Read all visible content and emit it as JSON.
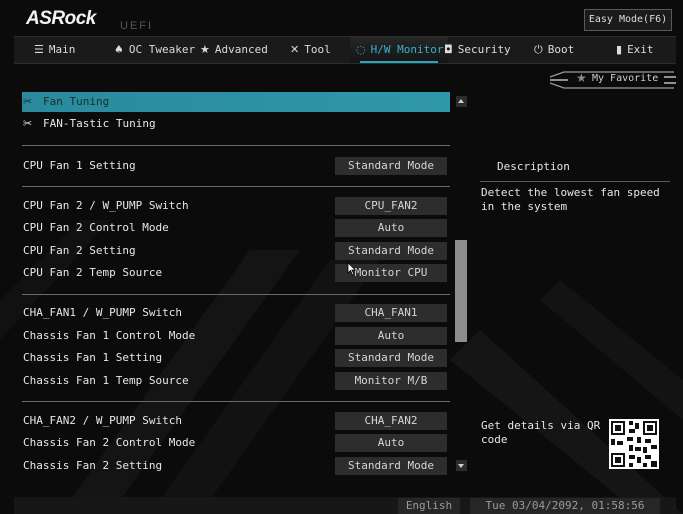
{
  "header": {
    "logo": "ASRock",
    "logo_sub": "UEFI",
    "easy_mode": "Easy Mode(F6)"
  },
  "tabs": [
    {
      "label": "Main",
      "icon": "list-icon"
    },
    {
      "label": "OC Tweaker",
      "icon": "flame-icon"
    },
    {
      "label": "Advanced",
      "icon": "star-icon"
    },
    {
      "label": "Tool",
      "icon": "wrench-icon"
    },
    {
      "label": "H/W Monitor",
      "icon": "monitor-icon",
      "active": true
    },
    {
      "label": "Security",
      "icon": "shield-icon"
    },
    {
      "label": "Boot",
      "icon": "power-icon"
    },
    {
      "label": "Exit",
      "icon": "exit-icon"
    }
  ],
  "favorite": {
    "label": "My Favorite",
    "icon": "star-icon"
  },
  "menu": {
    "fan_tuning": "Fan Tuning",
    "fan_tastic": "FAN-Tastic Tuning"
  },
  "settings": [
    {
      "label": "CPU Fan 1 Setting",
      "value": "Standard Mode"
    },
    {
      "label": "CPU Fan 2 / W_PUMP Switch",
      "value": "CPU_FAN2"
    },
    {
      "label": "CPU Fan 2 Control Mode",
      "value": "Auto"
    },
    {
      "label": "CPU Fan 2 Setting",
      "value": "Standard Mode"
    },
    {
      "label": "CPU Fan 2 Temp Source",
      "value": "Monitor CPU"
    },
    {
      "label": "CHA_FAN1 / W_PUMP Switch",
      "value": "CHA_FAN1"
    },
    {
      "label": "Chassis Fan 1 Control Mode",
      "value": "Auto"
    },
    {
      "label": "Chassis Fan 1 Setting",
      "value": "Standard Mode"
    },
    {
      "label": "Chassis Fan 1 Temp Source",
      "value": "Monitor M/B"
    },
    {
      "label": "CHA_FAN2 / W_PUMP Switch",
      "value": "CHA_FAN2"
    },
    {
      "label": "Chassis Fan 2 Control Mode",
      "value": "Auto"
    },
    {
      "label": "Chassis Fan 2 Setting",
      "value": "Standard Mode"
    }
  ],
  "description": {
    "title": "Description",
    "text": "Detect the lowest fan speed in the system",
    "qr_text": "Get details via QR code"
  },
  "footer": {
    "language": "English",
    "datetime": "Tue 03/04/2092, 01:58:56"
  },
  "colors": {
    "accent": "#2aa6bc",
    "highlight_row": "#2f8ea0",
    "value_box": "#2d2d2d"
  }
}
